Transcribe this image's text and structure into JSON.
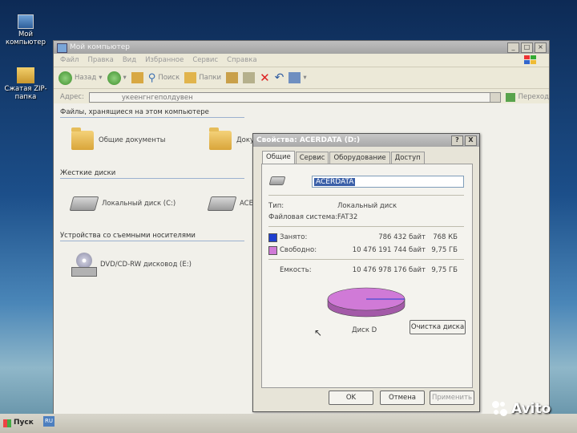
{
  "desktop": {
    "icons": [
      {
        "label": "Мой компьютер"
      },
      {
        "label": "Сжатая ZIP-папка"
      }
    ]
  },
  "window": {
    "title": "Мой компьютер",
    "menu": [
      "Файл",
      "Правка",
      "Вид",
      "Избранное",
      "Сервис",
      "Справка"
    ],
    "toolbar": {
      "back": "Назад",
      "search": "Поиск",
      "folders": "Папки"
    },
    "address": {
      "label": "Адрес:",
      "value": "укеенгнгеполдувен",
      "go": "Переход"
    },
    "sections": {
      "files": "Файлы, хранящиеся на этом компьютере",
      "hdd": "Жесткие диски",
      "removable": "Устройства со съемными носителями"
    },
    "items": {
      "shared_docs": "Общие документы",
      "docs_partial": "Доку",
      "local_c": "Локальный диск (C:)",
      "acer_partial": "ACER",
      "dvd": "DVD/CD-RW дисковод (E:)"
    }
  },
  "dialog": {
    "title": "Свойства: ACERDATA (D:)",
    "help": "?",
    "close": "X",
    "tabs": [
      "Общие",
      "Сервис",
      "Оборудование",
      "Доступ"
    ],
    "name": "ACERDATA",
    "type_label": "Тип:",
    "type_value": "Локальный диск",
    "fs_label": "Файловая система:",
    "fs_value": "FAT32",
    "used_label": "Занято:",
    "used_bytes": "786 432 байт",
    "used_size": "768 КБ",
    "free_label": "Свободно:",
    "free_bytes": "10 476 191 744 байт",
    "free_size": "9,75 ГБ",
    "capacity_label": "Емкость:",
    "capacity_bytes": "10 476 978 176 байт",
    "capacity_size": "9,75 ГБ",
    "disk_label": "Диск D",
    "cleanup": "Очистка диска",
    "ok": "OK",
    "cancel": "Отмена",
    "apply": "Применить",
    "colors": {
      "used": "#1f3fd0",
      "free": "#d07ad7"
    },
    "used_fraction": 0.0001
  },
  "taskbar": {
    "start": "Пуск",
    "lang": "RU"
  },
  "watermark": {
    "text": "Avito"
  }
}
